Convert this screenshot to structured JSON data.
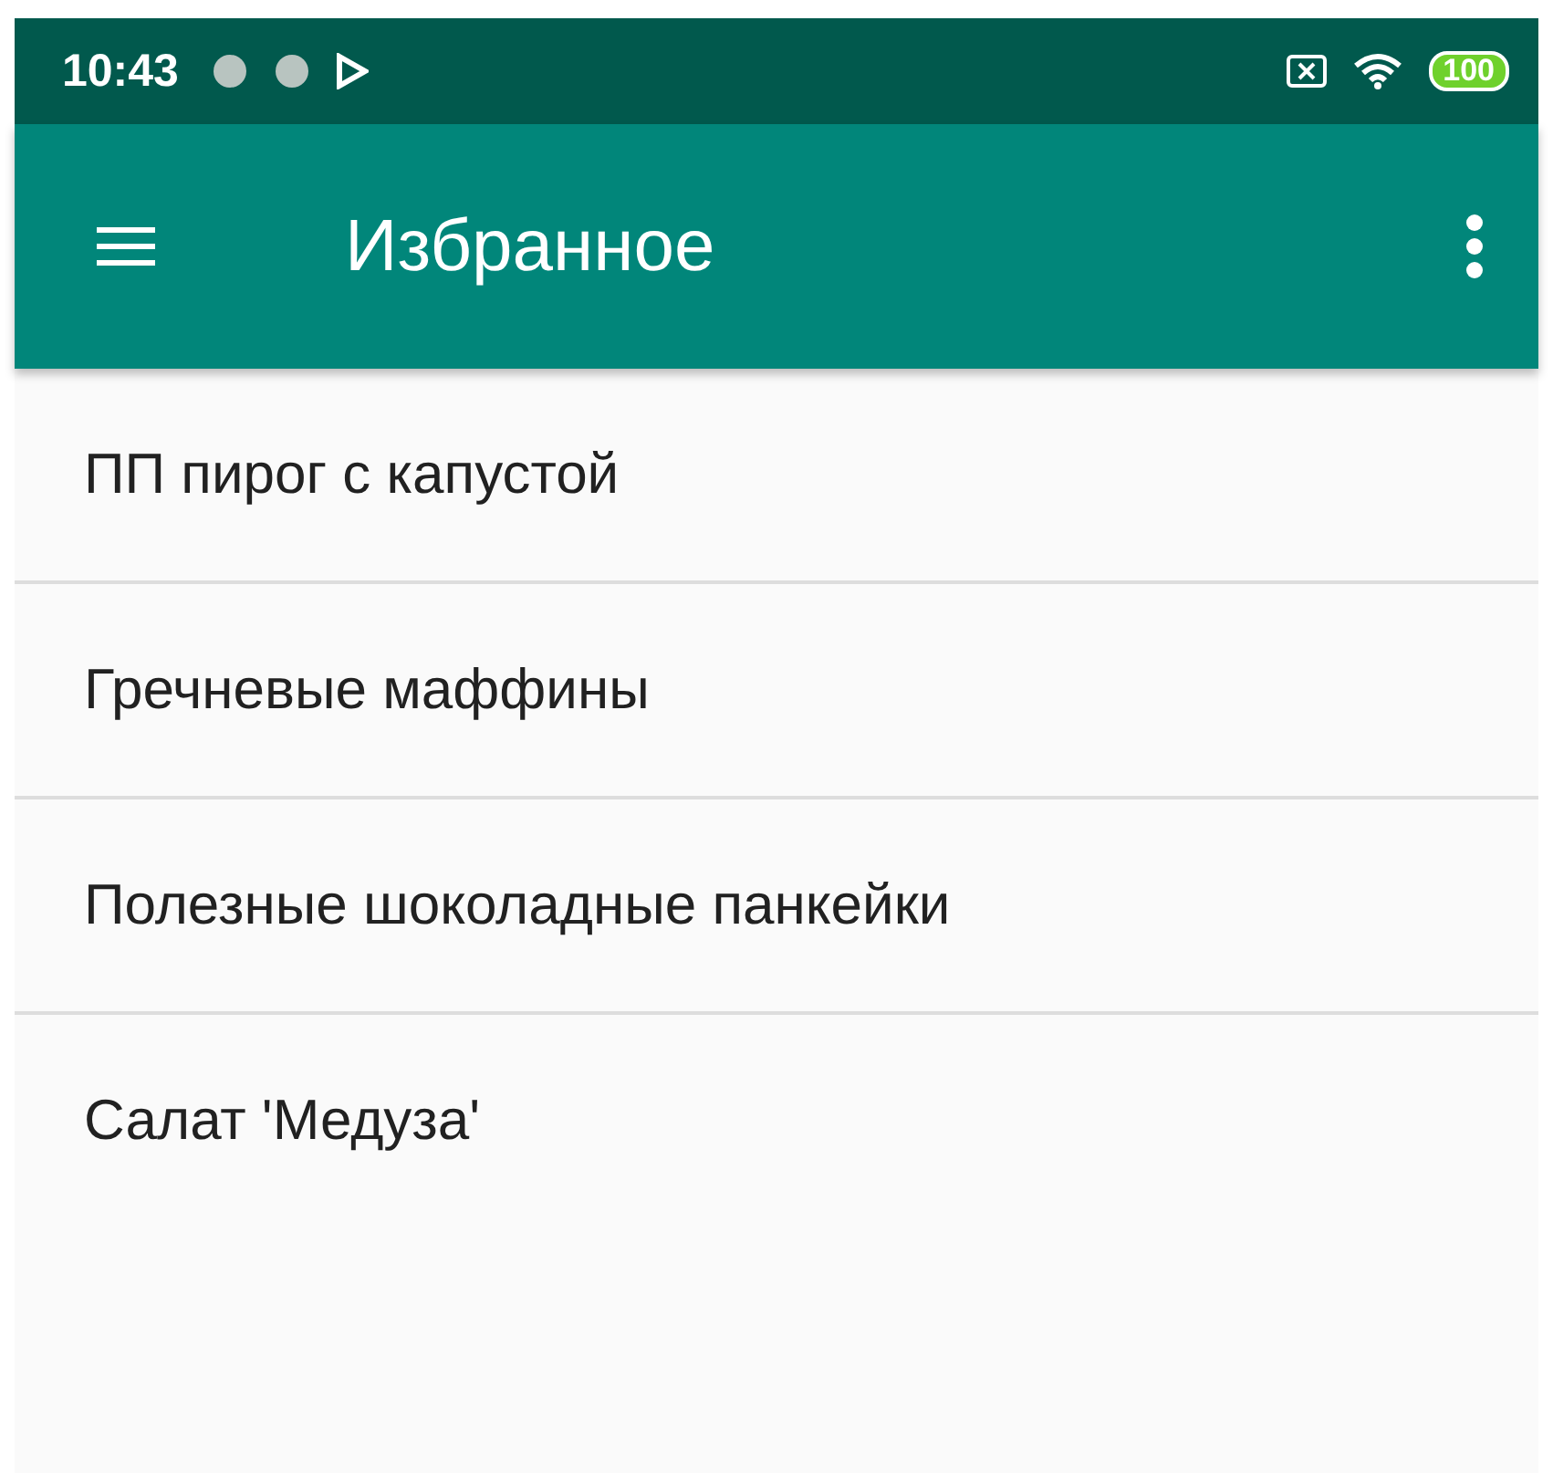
{
  "status_bar": {
    "time": "10:43",
    "battery": "100"
  },
  "app_bar": {
    "title": "Избранное"
  },
  "items": [
    {
      "label": "ПП пирог с капустой"
    },
    {
      "label": "Гречневые маффины"
    },
    {
      "label": "Полезные шоколадные панкейки"
    },
    {
      "label": "Салат 'Медуза'"
    }
  ]
}
